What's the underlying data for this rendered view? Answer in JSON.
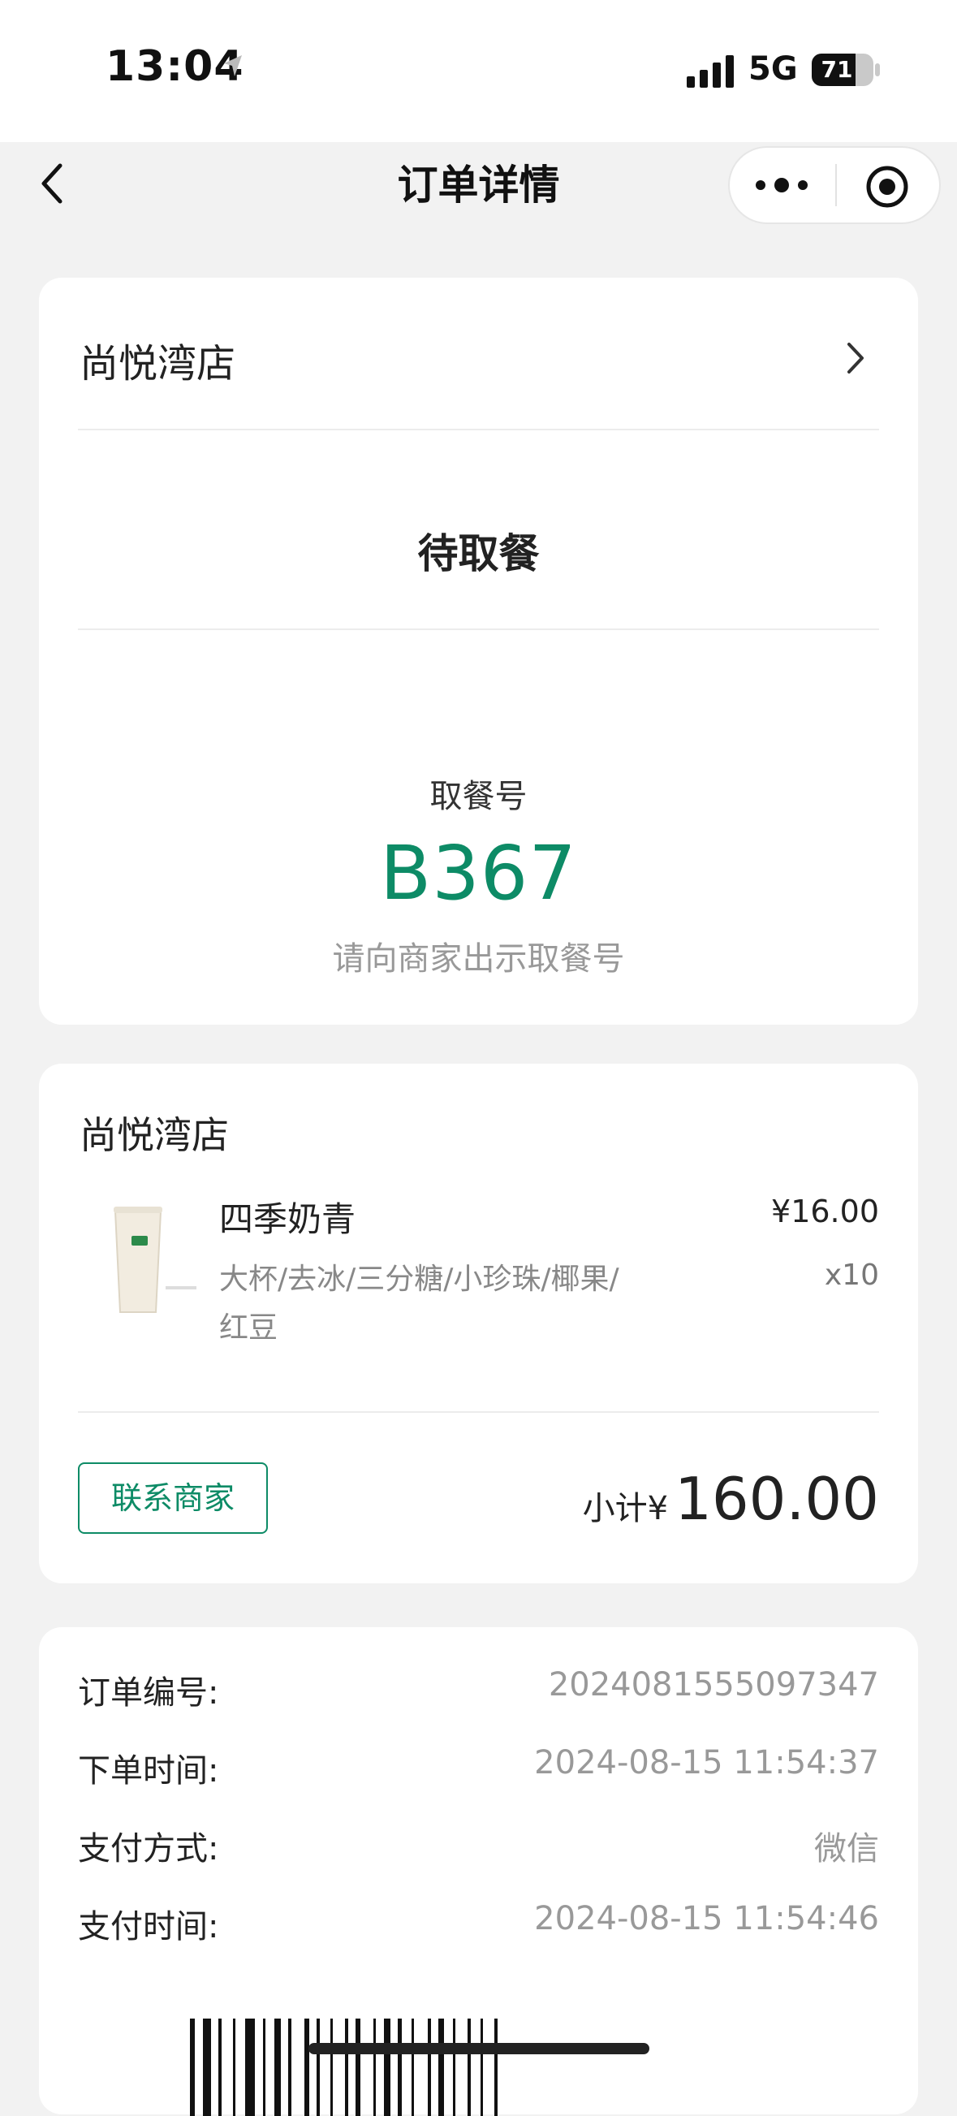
{
  "status_bar": {
    "time": "13:04",
    "network": "5G",
    "battery": "71",
    "battery_level": 0.71
  },
  "nav": {
    "title": "订单详情"
  },
  "pickup_card": {
    "store_name": "尚悦湾店",
    "status": "待取餐",
    "pickup_label": "取餐号",
    "pickup_number": "B367",
    "pickup_hint": "请向商家出示取餐号"
  },
  "order_card": {
    "store_name": "尚悦湾店",
    "item": {
      "name": "四季奶青",
      "spec": "大杯/去冰/三分糖/小珍珠/椰果/红豆",
      "price": "¥16.00",
      "quantity": "x10"
    },
    "contact_label": "联系商家",
    "subtotal_label": "小计¥",
    "subtotal_value": "160.00"
  },
  "info_card": {
    "rows": [
      {
        "label": "订单编号:",
        "value": "2024081555097347"
      },
      {
        "label": "下单时间:",
        "value": "2024-08-15 11:54:37"
      },
      {
        "label": "支付方式:",
        "value": "微信"
      },
      {
        "label": "支付时间:",
        "value": "2024-08-15 11:54:46"
      }
    ]
  },
  "colors": {
    "accent": "#0d8b66",
    "background": "#f2f2f2",
    "card": "#ffffff",
    "muted": "#999999"
  }
}
